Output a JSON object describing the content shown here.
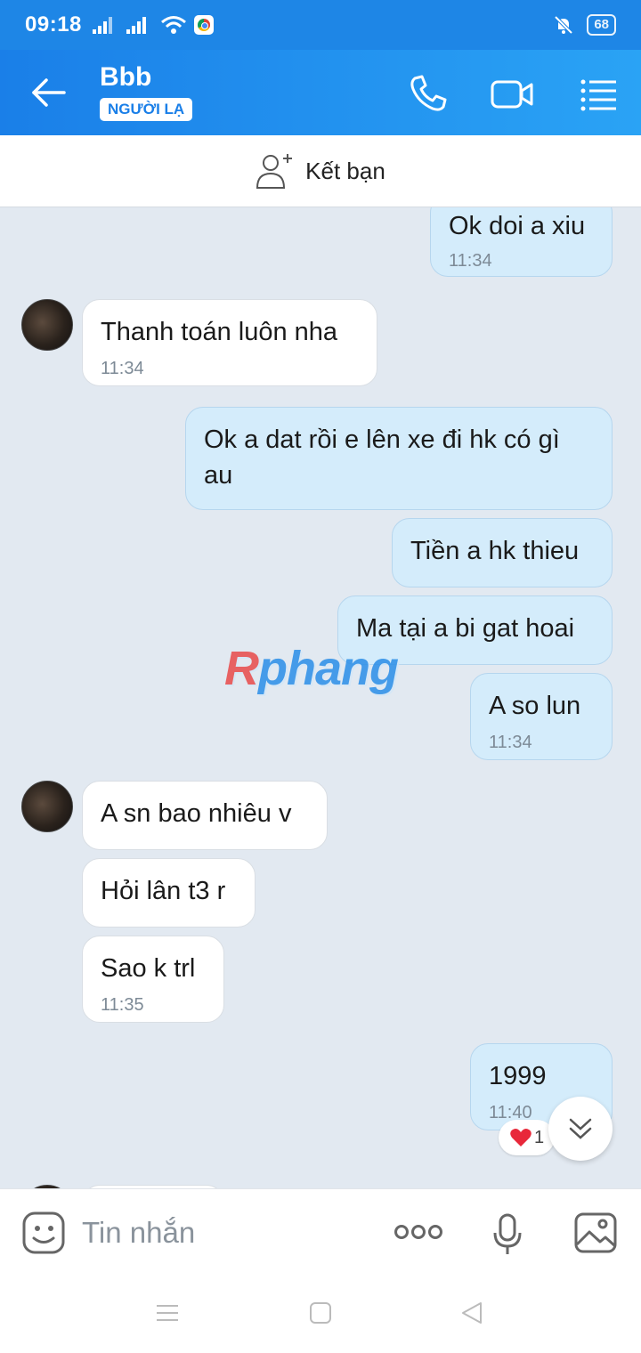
{
  "status_bar": {
    "time": "09:18",
    "battery": "68"
  },
  "header": {
    "contact_name": "Bbb",
    "stranger_badge": "NGƯỜI LẠ"
  },
  "friend_bar": {
    "label": "Kết bạn"
  },
  "messages": [
    {
      "direction": "out",
      "text": "Ok doi a xiu",
      "time": "11:34"
    },
    {
      "direction": "in",
      "text": "Thanh toán luôn nha",
      "time": "11:34"
    },
    {
      "direction": "out",
      "text": "Ok a dat rồi e lên xe đi hk có gì au",
      "text_line1": "Ok a dat rồi e lên xe đi hk có gì",
      "text_line2": "au"
    },
    {
      "direction": "out",
      "text": "Tiền a hk thieu"
    },
    {
      "direction": "out",
      "text": "Ma tại a bi gat hoai"
    },
    {
      "direction": "out",
      "text": "A so lun",
      "time": "11:34"
    },
    {
      "direction": "in",
      "text": "A sn bao nhiêu v"
    },
    {
      "direction": "in",
      "text": "Hỏi lân t3 r"
    },
    {
      "direction": "in",
      "text": "Sao k trl",
      "time": "11:35"
    },
    {
      "direction": "out",
      "text": "1999",
      "time": "11:40",
      "reaction_count": "1"
    }
  ],
  "watermark": {
    "first": "R",
    "rest": "phang"
  },
  "input_bar": {
    "placeholder": "Tin nhắn"
  },
  "colors": {
    "header_start": "#1a7fe8",
    "header_end": "#2aa3f5",
    "outgoing_bubble": "#d4ecfb",
    "incoming_bubble": "#ffffff",
    "chat_background": "#e2e9f1"
  }
}
